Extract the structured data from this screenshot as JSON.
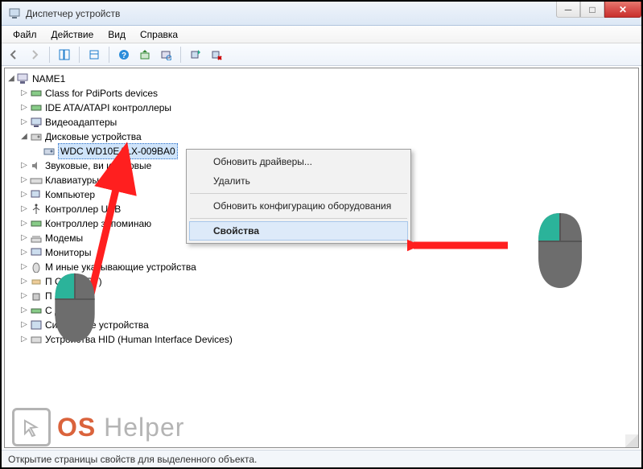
{
  "window": {
    "title": "Диспетчер устройств"
  },
  "menu": {
    "file": "Файл",
    "action": "Действие",
    "view": "Вид",
    "help": "Справка"
  },
  "tree": {
    "root": "NAME1",
    "items": [
      "Class for PdiPorts devices",
      "IDE ATA/ATAPI контроллеры",
      "Видеоадаптеры",
      "Дисковые устройства",
      "Звуковые, ви          и игровые",
      "Клавиатуры",
      "Компьютер",
      "Контроллер   USB",
      "Контроллер   запоминаю",
      "Модемы",
      "Мониторы",
      "М              иные указывающие устройства",
      "П              ОМ и LPT)",
      "П              ры",
      "С              даптеры",
      "Системные устройства",
      "Устройства HID (Human Interface Devices)"
    ],
    "selected_device": "WDC WD10EALX-009BA0"
  },
  "context_menu": {
    "update_drivers": "Обновить драйверы...",
    "delete": "Удалить",
    "scan_hw": "Обновить конфигурацию оборудования",
    "properties": "Свойства"
  },
  "status": "Открытие страницы свойств для выделенного объекта.",
  "logo": {
    "os": "OS",
    "helper": "Helper"
  },
  "colors": {
    "accent_teal": "#2bb39a",
    "arrow_red": "#ff1f1f"
  }
}
